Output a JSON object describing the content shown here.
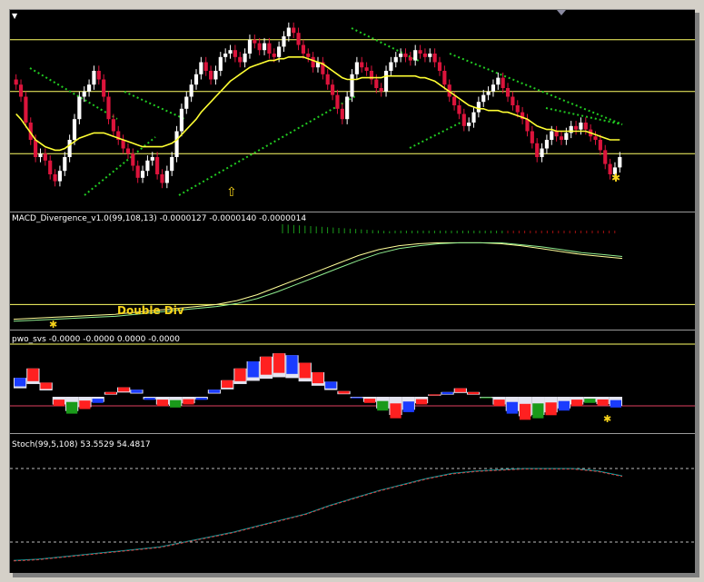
{
  "panes": {
    "macd_label": "MACD_Divergence_v1.0(99,108,13) -0.0000127 -0.0000140 -0.0000014",
    "pwo_label": "pwo_svs -0.0000 -0.0000 0.0000 -0.0000",
    "stoch_label": "Stoch(99,5,108) 53.5529 54.4817",
    "annotation": "Double Div"
  },
  "colors": {
    "background": "#000000",
    "bull_candle": "#ffffff",
    "bear_candle": "#dc143c",
    "moving_average": "#ffff33",
    "trendline": "#22cc22",
    "level_line": "#ffff66",
    "macd_main": "#ffff99",
    "macd_signal": "#90ee90",
    "pwo_red": "#ff2020",
    "pwo_blue": "#1a3cff",
    "pwo_green": "#1a9a1a",
    "pwo_area": "#e4e4f0",
    "stoch_main": "#00a0a0",
    "stoch_signal": "#e04040",
    "arrow_marker": "#f7d31a"
  },
  "icons": {
    "corner": "down-triangle-icon",
    "up_arrow": "up-arrow-icon",
    "signal": "asterisk-icon"
  },
  "chart_data": [
    {
      "type": "candlestick",
      "pane": "price",
      "closes": [
        0.62,
        0.55,
        0.4,
        0.3,
        0.2,
        0.22,
        0.18,
        0.1,
        0.06,
        0.12,
        0.2,
        0.3,
        0.42,
        0.55,
        0.58,
        0.62,
        0.7,
        0.65,
        0.55,
        0.42,
        0.35,
        0.3,
        0.25,
        0.22,
        0.15,
        0.08,
        0.12,
        0.18,
        0.2,
        0.1,
        0.05,
        0.12,
        0.2,
        0.35,
        0.48,
        0.55,
        0.62,
        0.68,
        0.75,
        0.7,
        0.65,
        0.7,
        0.78,
        0.8,
        0.82,
        0.78,
        0.75,
        0.8,
        0.88,
        0.86,
        0.82,
        0.86,
        0.8,
        0.78,
        0.84,
        0.9,
        0.95,
        0.92,
        0.85,
        0.8,
        0.78,
        0.72,
        0.75,
        0.68,
        0.62,
        0.56,
        0.48,
        0.42,
        0.55,
        0.68,
        0.75,
        0.72,
        0.7,
        0.65,
        0.6,
        0.58,
        0.7,
        0.75,
        0.78,
        0.8,
        0.78,
        0.76,
        0.82,
        0.8,
        0.78,
        0.8,
        0.75,
        0.7,
        0.62,
        0.55,
        0.5,
        0.45,
        0.38,
        0.4,
        0.46,
        0.52,
        0.56,
        0.58,
        0.62,
        0.66,
        0.6,
        0.55,
        0.5,
        0.46,
        0.42,
        0.35,
        0.28,
        0.2,
        0.25,
        0.3,
        0.35,
        0.32,
        0.3,
        0.34,
        0.38,
        0.36,
        0.4,
        0.36,
        0.32,
        0.3,
        0.24,
        0.16,
        0.1,
        0.14,
        0.2
      ],
      "moving_average": [
        0.45,
        0.42,
        0.38,
        0.34,
        0.3,
        0.28,
        0.26,
        0.25,
        0.24,
        0.24,
        0.25,
        0.27,
        0.29,
        0.31,
        0.32,
        0.33,
        0.34,
        0.34,
        0.34,
        0.33,
        0.32,
        0.31,
        0.3,
        0.29,
        0.28,
        0.27,
        0.26,
        0.26,
        0.26,
        0.26,
        0.26,
        0.27,
        0.28,
        0.3,
        0.33,
        0.36,
        0.39,
        0.42,
        0.46,
        0.49,
        0.52,
        0.55,
        0.58,
        0.61,
        0.64,
        0.66,
        0.68,
        0.7,
        0.72,
        0.73,
        0.74,
        0.75,
        0.76,
        0.76,
        0.77,
        0.77,
        0.78,
        0.78,
        0.78,
        0.78,
        0.77,
        0.76,
        0.75,
        0.74,
        0.72,
        0.7,
        0.68,
        0.66,
        0.65,
        0.65,
        0.65,
        0.66,
        0.66,
        0.66,
        0.66,
        0.66,
        0.67,
        0.67,
        0.67,
        0.67,
        0.67,
        0.67,
        0.67,
        0.66,
        0.66,
        0.65,
        0.64,
        0.62,
        0.6,
        0.58,
        0.56,
        0.54,
        0.52,
        0.5,
        0.49,
        0.48,
        0.48,
        0.47,
        0.47,
        0.47,
        0.46,
        0.46,
        0.45,
        0.44,
        0.43,
        0.42,
        0.4,
        0.38,
        0.37,
        0.36,
        0.36,
        0.35,
        0.35,
        0.35,
        0.35,
        0.35,
        0.35,
        0.35,
        0.34,
        0.33,
        0.32,
        0.31,
        0.3,
        0.3,
        0.3
      ],
      "levels": [
        0.22,
        0.58,
        0.88
      ]
    },
    {
      "type": "line",
      "pane": "macd",
      "series": [
        {
          "values": [
            0.05,
            0.06,
            0.07,
            0.08,
            0.09,
            0.1,
            0.12,
            0.14,
            0.16,
            0.18,
            0.2,
            0.24,
            0.3,
            0.38,
            0.46,
            0.54,
            0.62,
            0.7,
            0.76,
            0.8,
            0.82,
            0.83,
            0.83,
            0.83,
            0.82,
            0.8,
            0.77,
            0.74,
            0.71,
            0.69,
            0.67
          ]
        },
        {
          "values": [
            0.03,
            0.04,
            0.05,
            0.06,
            0.07,
            0.08,
            0.1,
            0.12,
            0.14,
            0.16,
            0.18,
            0.21,
            0.26,
            0.33,
            0.41,
            0.49,
            0.57,
            0.65,
            0.72,
            0.77,
            0.8,
            0.82,
            0.83,
            0.83,
            0.83,
            0.81,
            0.79,
            0.76,
            0.73,
            0.71,
            0.69
          ]
        }
      ],
      "levels": [
        0.2
      ]
    },
    {
      "type": "bar",
      "pane": "pwo",
      "values": [
        0.4,
        0.6,
        0.3,
        -0.3,
        -0.55,
        -0.4,
        -0.2,
        0.1,
        0.2,
        0.15,
        -0.1,
        -0.3,
        -0.35,
        -0.25,
        -0.1,
        0.15,
        0.35,
        0.6,
        0.75,
        0.85,
        0.92,
        0.88,
        0.72,
        0.52,
        0.32,
        0.12,
        -0.05,
        -0.2,
        -0.45,
        -0.7,
        -0.5,
        -0.25,
        0.05,
        0.1,
        0.18,
        0.1,
        -0.05,
        -0.3,
        -0.55,
        -0.75,
        -0.7,
        -0.6,
        -0.45,
        -0.3,
        -0.2,
        -0.28,
        -0.35
      ],
      "ylim": [
        -1,
        1
      ],
      "levels": [
        0.9
      ]
    },
    {
      "type": "line",
      "pane": "stoch",
      "series": [
        {
          "values": [
            0.05,
            0.06,
            0.08,
            0.1,
            0.12,
            0.14,
            0.16,
            0.2,
            0.24,
            0.28,
            0.33,
            0.38,
            0.43,
            0.5,
            0.56,
            0.62,
            0.67,
            0.72,
            0.76,
            0.78,
            0.79,
            0.8,
            0.8,
            0.8,
            0.78,
            0.74
          ]
        },
        {
          "values": [
            0.05,
            0.06,
            0.08,
            0.1,
            0.12,
            0.14,
            0.16,
            0.2,
            0.24,
            0.28,
            0.33,
            0.38,
            0.43,
            0.5,
            0.56,
            0.62,
            0.67,
            0.72,
            0.76,
            0.78,
            0.79,
            0.8,
            0.8,
            0.8,
            0.78,
            0.74
          ]
        }
      ],
      "levels": [
        0.2,
        0.8
      ]
    }
  ]
}
